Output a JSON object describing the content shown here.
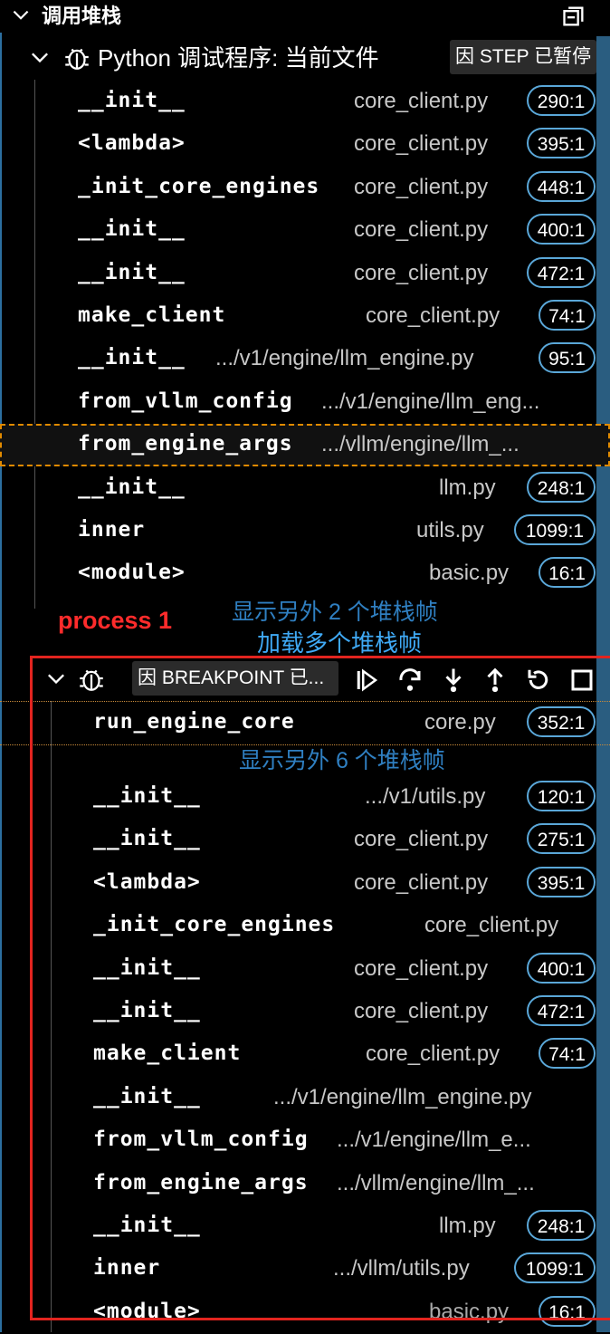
{
  "header": {
    "title": "调用堆栈"
  },
  "session1": {
    "name": "Python 调试程序: 当前文件",
    "badge": "因 STEP 已暂停",
    "frames": [
      {
        "fn": "__init__",
        "file": "core_client.py",
        "pos": "290:1"
      },
      {
        "fn": "<lambda>",
        "file": "core_client.py",
        "pos": "395:1"
      },
      {
        "fn": "_init_core_engines",
        "file": "core_client.py",
        "pos": "448:1"
      },
      {
        "fn": "__init__",
        "file": "core_client.py",
        "pos": "400:1"
      },
      {
        "fn": "__init__",
        "file": "core_client.py",
        "pos": "472:1"
      },
      {
        "fn": "make_client",
        "file": "core_client.py",
        "pos": "74:1"
      },
      {
        "fn": "__init__",
        "file": ".../v1/engine/llm_engine.py",
        "pos": "95:1"
      },
      {
        "fn": "from_vllm_config",
        "file": ".../v1/engine/llm_eng...",
        "pos": ""
      },
      {
        "fn": "from_engine_args",
        "file": ".../vllm/engine/llm_...",
        "pos": ""
      },
      {
        "fn": "__init__",
        "file": "llm.py",
        "pos": "248:1"
      },
      {
        "fn": "inner",
        "file": "utils.py",
        "pos": "1099:1"
      },
      {
        "fn": "<module>",
        "file": "basic.py",
        "pos": "16:1"
      }
    ],
    "show_more": "显示另外 2 个堆栈帧"
  },
  "annotation": {
    "process_label": "process 1",
    "load_more": "加载多个堆栈帧"
  },
  "session2": {
    "badge": "因 BREAKPOINT 已...",
    "first_frame": {
      "fn": "run_engine_core",
      "file": "core.py",
      "pos": "352:1"
    },
    "show_more": "显示另外 6 个堆栈帧",
    "frames": [
      {
        "fn": "__init__",
        "file": ".../v1/utils.py",
        "pos": "120:1"
      },
      {
        "fn": "__init__",
        "file": "core_client.py",
        "pos": "275:1"
      },
      {
        "fn": "<lambda>",
        "file": "core_client.py",
        "pos": "395:1"
      },
      {
        "fn": "_init_core_engines",
        "file": "core_client.py",
        "pos": ""
      },
      {
        "fn": "__init__",
        "file": "core_client.py",
        "pos": "400:1"
      },
      {
        "fn": "__init__",
        "file": "core_client.py",
        "pos": "472:1"
      },
      {
        "fn": "make_client",
        "file": "core_client.py",
        "pos": "74:1"
      },
      {
        "fn": "__init__",
        "file": ".../v1/engine/llm_engine.py",
        "pos": ""
      },
      {
        "fn": "from_vllm_config",
        "file": ".../v1/engine/llm_e...",
        "pos": ""
      },
      {
        "fn": "from_engine_args",
        "file": ".../vllm/engine/llm_...",
        "pos": ""
      },
      {
        "fn": "__init__",
        "file": "llm.py",
        "pos": "248:1"
      },
      {
        "fn": "inner",
        "file": ".../vllm/utils.py",
        "pos": "1099:1"
      },
      {
        "fn": "<module>",
        "file": "basic.py",
        "pos": "16:1"
      }
    ]
  },
  "icons": {
    "header_chevron": "chevron-down-icon",
    "collapse_all": "collapse-all-icon",
    "session_bug": "bug-icon",
    "continue": "continue-icon",
    "step_over": "step-over-icon",
    "step_into": "step-into-icon",
    "step_out": "step-out-icon",
    "restart": "restart-icon",
    "stop": "stop-icon"
  },
  "colors": {
    "position_badge_border": "#5aa7d8",
    "annotation_red": "#e2241f",
    "link_blue": "#2f7fc1"
  }
}
